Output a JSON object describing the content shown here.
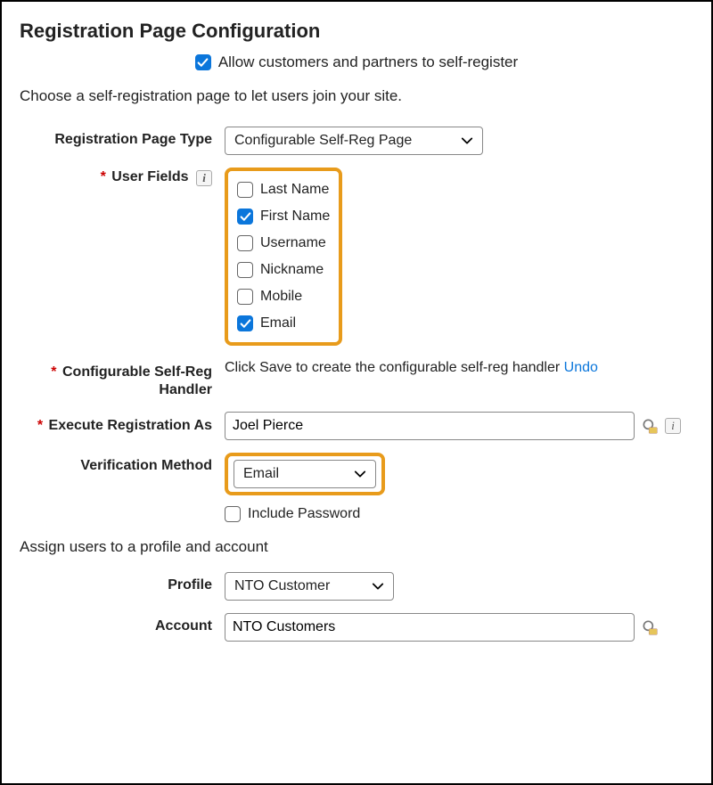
{
  "title": "Registration Page Configuration",
  "allow_self_register": {
    "checked": true,
    "label": "Allow customers and partners to self-register"
  },
  "description": "Choose a self-registration page to let users join your site.",
  "registration_page_type": {
    "label": "Registration Page Type",
    "value": "Configurable Self-Reg Page"
  },
  "user_fields": {
    "label": "User Fields",
    "options": [
      {
        "label": "Last Name",
        "checked": false
      },
      {
        "label": "First Name",
        "checked": true
      },
      {
        "label": "Username",
        "checked": false
      },
      {
        "label": "Nickname",
        "checked": false
      },
      {
        "label": "Mobile",
        "checked": false
      },
      {
        "label": "Email",
        "checked": true
      }
    ]
  },
  "handler": {
    "label": "Configurable Self-Reg Handler",
    "message": "Click Save to create the configurable self-reg handler",
    "undo": "Undo"
  },
  "execute_as": {
    "label": "Execute Registration As",
    "value": "Joel Pierce"
  },
  "verification_method": {
    "label": "Verification Method",
    "value": "Email"
  },
  "include_password": {
    "checked": false,
    "label": "Include Password"
  },
  "assign_section": "Assign users to a profile and account",
  "profile": {
    "label": "Profile",
    "value": "NTO Customer"
  },
  "account": {
    "label": "Account",
    "value": "NTO Customers"
  }
}
